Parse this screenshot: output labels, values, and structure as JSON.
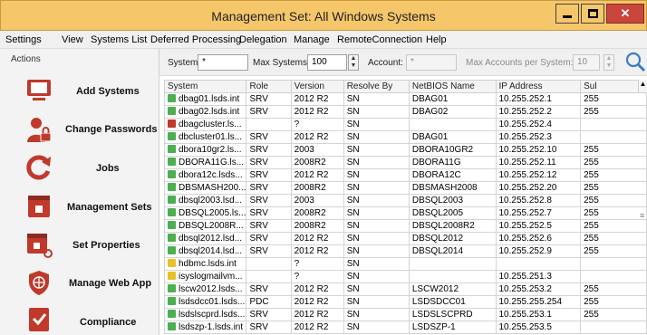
{
  "window": {
    "title": "Management Set: All Windows Systems"
  },
  "menu": [
    "Settings",
    "View",
    "Systems List",
    "Deferred Processing",
    "Delegation",
    "Manage",
    "RemoteConnection",
    "Help"
  ],
  "sidebar": {
    "header": "Actions",
    "items": [
      {
        "label": "Add Systems",
        "icon": "monitor-icon"
      },
      {
        "label": "Change Passwords",
        "icon": "user-lock-icon"
      },
      {
        "label": "Jobs",
        "icon": "refresh-icon"
      },
      {
        "label": "Management Sets",
        "icon": "window-icon"
      },
      {
        "label": "Set Properties",
        "icon": "window-gear-icon"
      },
      {
        "label": "Manage Web App",
        "icon": "globe-icon"
      },
      {
        "label": "Compliance",
        "icon": "checklist-icon"
      }
    ]
  },
  "filters": {
    "system_label": "System:",
    "system_value": "*",
    "max_systems_label": "Max Systems:",
    "max_systems_value": "100",
    "account_label": "Account:",
    "account_value": "*",
    "max_accounts_label": "Max Accounts per System:",
    "max_accounts_value": "10"
  },
  "grid": {
    "columns": [
      "System",
      "Role",
      "Version",
      "Resolve By",
      "NetBIOS Name",
      "IP Address",
      "Sul"
    ],
    "rows": [
      {
        "icon": "green",
        "cells": [
          "dbag01.lsds.int",
          "SRV",
          "2012 R2",
          "SN",
          "DBAG01",
          "10.255.252.1",
          "255"
        ]
      },
      {
        "icon": "green",
        "cells": [
          "dbag02.lsds.int",
          "SRV",
          "2012 R2",
          "SN",
          "DBAG02",
          "10.255.252.2",
          "255"
        ]
      },
      {
        "icon": "red",
        "cells": [
          "dbagcluster.ls...",
          "",
          "?",
          "SN",
          "",
          "10.255.252.4",
          ""
        ]
      },
      {
        "icon": "green",
        "cells": [
          "dbcluster01.ls...",
          "SRV",
          "2012 R2",
          "SN",
          "DBAG01",
          "10.255.252.3",
          ""
        ]
      },
      {
        "icon": "green",
        "cells": [
          "dbora10gr2.ls...",
          "SRV",
          "2003",
          "SN",
          "DBORA10GR2",
          "10.255.252.10",
          "255"
        ]
      },
      {
        "icon": "green",
        "cells": [
          "DBORA11G.ls...",
          "SRV",
          "2008R2",
          "SN",
          "DBORA11G",
          "10.255.252.11",
          "255"
        ]
      },
      {
        "icon": "green",
        "cells": [
          "dbora12c.lsds...",
          "SRV",
          "2012 R2",
          "SN",
          "DBORA12C",
          "10.255.252.12",
          "255"
        ]
      },
      {
        "icon": "green",
        "cells": [
          "DBSMASH200...",
          "SRV",
          "2008R2",
          "SN",
          "DBSMASH2008",
          "10.255.252.20",
          "255"
        ]
      },
      {
        "icon": "green",
        "cells": [
          "dbsql2003.lsd...",
          "SRV",
          "2003",
          "SN",
          "DBSQL2003",
          "10.255.252.8",
          "255"
        ]
      },
      {
        "icon": "green",
        "cells": [
          "DBSQL2005.ls...",
          "SRV",
          "2008R2",
          "SN",
          "DBSQL2005",
          "10.255.252.7",
          "255"
        ]
      },
      {
        "icon": "green",
        "cells": [
          "DBSQL2008R...",
          "SRV",
          "2008R2",
          "SN",
          "DBSQL2008R2",
          "10.255.252.5",
          "255"
        ]
      },
      {
        "icon": "green",
        "cells": [
          "dbsql2012.lsd...",
          "SRV",
          "2012 R2",
          "SN",
          "DBSQL2012",
          "10.255.252.6",
          "255"
        ]
      },
      {
        "icon": "green",
        "cells": [
          "dbsql2014.lsd...",
          "SRV",
          "2012 R2",
          "SN",
          "DBSQL2014",
          "10.255.252.9",
          "255"
        ]
      },
      {
        "icon": "yellow",
        "cells": [
          "hdbmc.lsds.int",
          "",
          "?",
          "SN",
          "",
          "",
          ""
        ]
      },
      {
        "icon": "yellow",
        "cells": [
          "isyslogmailvm...",
          "",
          "?",
          "SN",
          "",
          "10.255.251.3",
          ""
        ]
      },
      {
        "icon": "green",
        "cells": [
          "lscw2012.lsds...",
          "SRV",
          "2012 R2",
          "SN",
          "LSCW2012",
          "10.255.253.2",
          "255"
        ]
      },
      {
        "icon": "green",
        "cells": [
          "lsdsdcc01.lsds...",
          "PDC",
          "2012 R2",
          "SN",
          "LSDSDCC01",
          "10.255.255.254",
          "255"
        ]
      },
      {
        "icon": "green",
        "cells": [
          "lsdslscprd.lsds...",
          "SRV",
          "2012 R2",
          "SN",
          "LSDSLSCPRD",
          "10.255.253.1",
          "255"
        ]
      },
      {
        "icon": "green",
        "cells": [
          "lsdszp-1.lsds.int",
          "SRV",
          "2012 R2",
          "SN",
          "LSDSZP-1",
          "10.255.253.5",
          ""
        ]
      }
    ]
  },
  "colors": {
    "titlebar": "#f5c66a",
    "close": "#c9463d",
    "icon_red": "#c0392b"
  }
}
